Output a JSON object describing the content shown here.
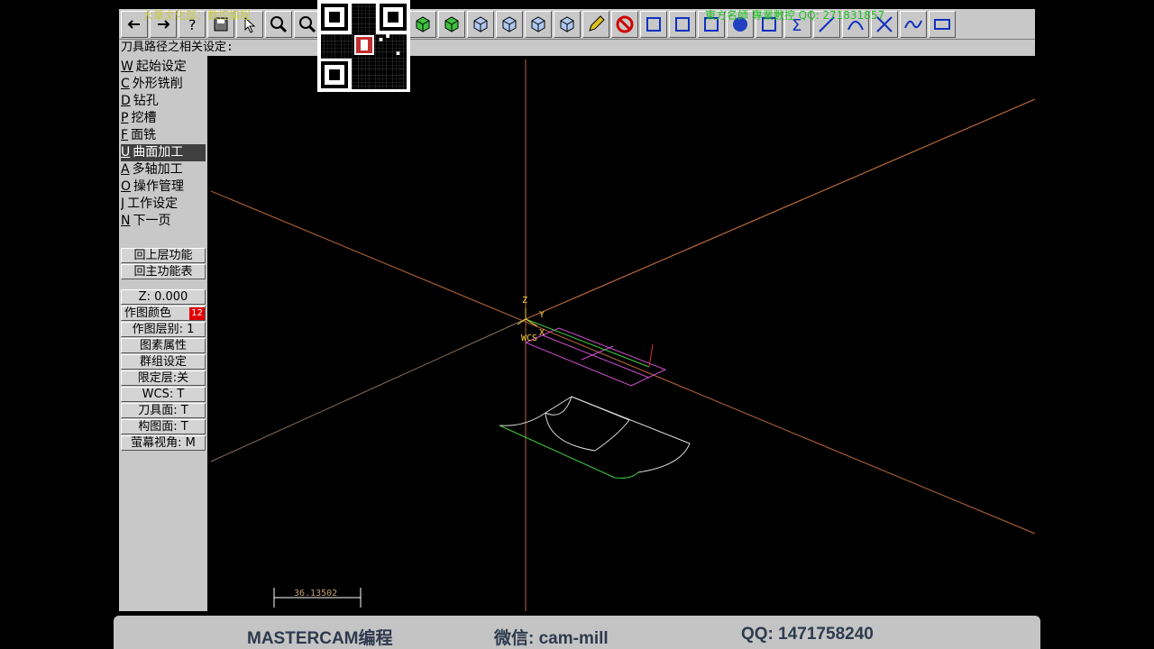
{
  "toolbar": {
    "marquee_left": "大華文化部：數控編程",
    "marquee_right": "東方名師 專業數控 QQ: 271831857",
    "buttons": [
      "back-arrow-icon",
      "forward-arrow-icon",
      "help-icon",
      "save-icon",
      "cursor-icon",
      "zoom-in-icon",
      "zoom-out-icon",
      "rotate-icon",
      "view-isometric-icon",
      "view-top-icon",
      "view-front-icon",
      "view-side-icon",
      "cube-top-icon",
      "cube-front-icon",
      "cube-right-icon",
      "cube-iso-icon",
      "pencil-icon",
      "no-entry-icon",
      "move-icon",
      "copy-icon",
      "rotate-arrow-icon",
      "sphere-icon",
      "group-icon",
      "sigma-icon",
      "line-icon",
      "arc-icon",
      "trim-icon",
      "spline-icon",
      "rectangle-icon"
    ]
  },
  "prompt": {
    "text": "刀具路径之相关设定:"
  },
  "menu": {
    "items": [
      {
        "hotkey": "W",
        "label": "起始设定"
      },
      {
        "hotkey": "C",
        "label": "外形铣削"
      },
      {
        "hotkey": "D",
        "label": "钻孔"
      },
      {
        "hotkey": "P",
        "label": "挖槽"
      },
      {
        "hotkey": "F",
        "label": "面铣"
      },
      {
        "hotkey": "U",
        "label": "曲面加工"
      },
      {
        "hotkey": "A",
        "label": "多轴加工"
      },
      {
        "hotkey": "O",
        "label": "操作管理"
      },
      {
        "hotkey": "J",
        "label": "工作设定"
      },
      {
        "hotkey": "N",
        "label": "下一页"
      }
    ],
    "selected_index": 5,
    "nav_buttons": [
      "回上层功能",
      "回主功能表"
    ]
  },
  "status": {
    "z_value": "Z:  0.000",
    "color_label": "作图颜色",
    "color_value": "12",
    "level": "作图层别: 1",
    "attributes": "图素属性",
    "group": "群组设定",
    "limit_level": "限定层:关",
    "wcs": "WCS:  T",
    "tool_plane": "刀具面: T",
    "construction_plane": "构图面: T",
    "screen_view": "萤幕视角: M"
  },
  "viewport": {
    "axis_z": "Z",
    "axis_y": "Y",
    "axis_x": "X",
    "wcs_label": "WCS",
    "scale_value": "36.13502"
  },
  "footer": {
    "left": "MASTERCAM编程",
    "middle": "微信: cam-mill",
    "right": "QQ: 1471758240"
  },
  "colors": {
    "panel_bg": "#c8c8c8",
    "selected_bg": "#404040",
    "axis_orange": "#c8603a",
    "axis_gray": "#8a6a5a",
    "toolpath_magenta": "#d050d0",
    "surface_green": "#40d040",
    "badge_red": "#e00000",
    "footer_text": "#2e3a4e"
  }
}
